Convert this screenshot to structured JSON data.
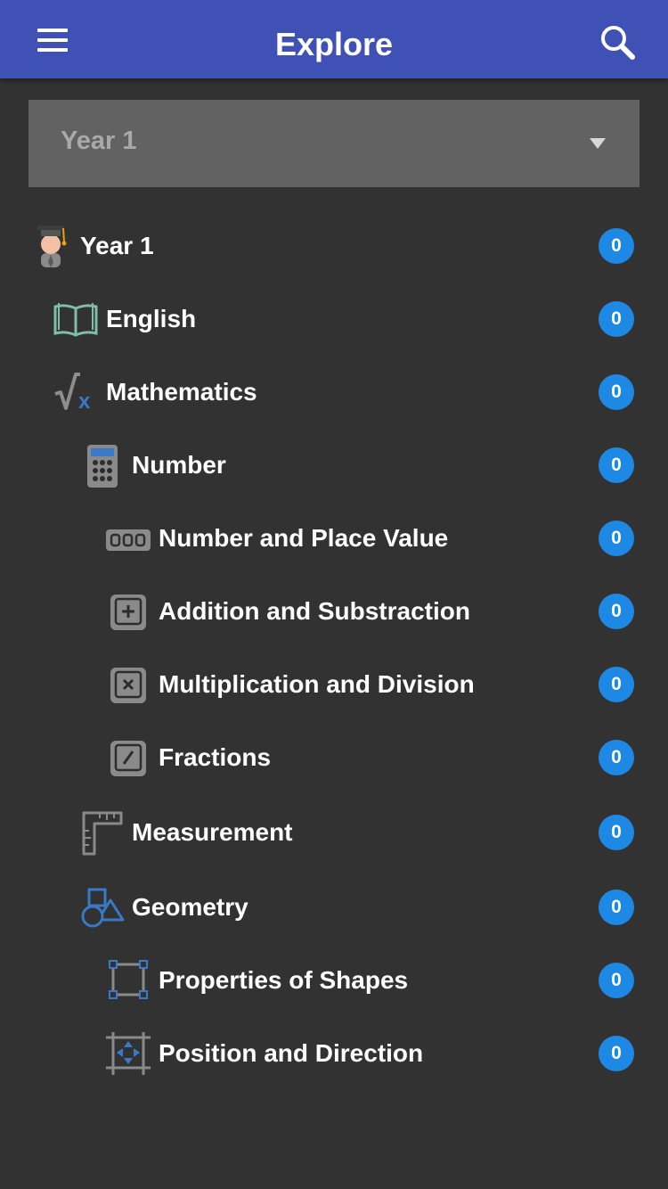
{
  "appbar": {
    "title": "Explore",
    "menu_icon": "hamburger-menu-icon",
    "search_icon": "search-icon"
  },
  "selector": {
    "value": "Year 1",
    "icon": "dropdown-caret-icon"
  },
  "tree": [
    {
      "label": "Year 1",
      "count": "0",
      "icon": "graduate-icon",
      "level": 0
    },
    {
      "label": "English",
      "count": "0",
      "icon": "open-book-icon",
      "level": 1
    },
    {
      "label": "Mathematics",
      "count": "0",
      "icon": "square-root-icon",
      "level": 1
    },
    {
      "label": "Number",
      "count": "0",
      "icon": "calculator-icon",
      "level": 2
    },
    {
      "label": "Number and Place Value",
      "count": "0",
      "icon": "digits-counter-icon",
      "level": 3
    },
    {
      "label": "Addition and Substraction",
      "count": "0",
      "icon": "plus-key-icon",
      "level": 3
    },
    {
      "label": "Multiplication and Division",
      "count": "0",
      "icon": "times-key-icon",
      "level": 3
    },
    {
      "label": "Fractions",
      "count": "0",
      "icon": "slash-key-icon",
      "level": 3
    },
    {
      "label": "Measurement",
      "count": "0",
      "icon": "ruler-square-icon",
      "level": 2
    },
    {
      "label": "Geometry",
      "count": "0",
      "icon": "shapes-icon",
      "level": 2
    },
    {
      "label": "Properties of Shapes",
      "count": "0",
      "icon": "selection-box-icon",
      "level": 3
    },
    {
      "label": "Position and Direction",
      "count": "0",
      "icon": "move-arrows-icon",
      "level": 3
    }
  ],
  "colors": {
    "appbar": "#3f51b5",
    "background": "#323232",
    "selector": "#626262",
    "badge": "#1e88e5"
  }
}
